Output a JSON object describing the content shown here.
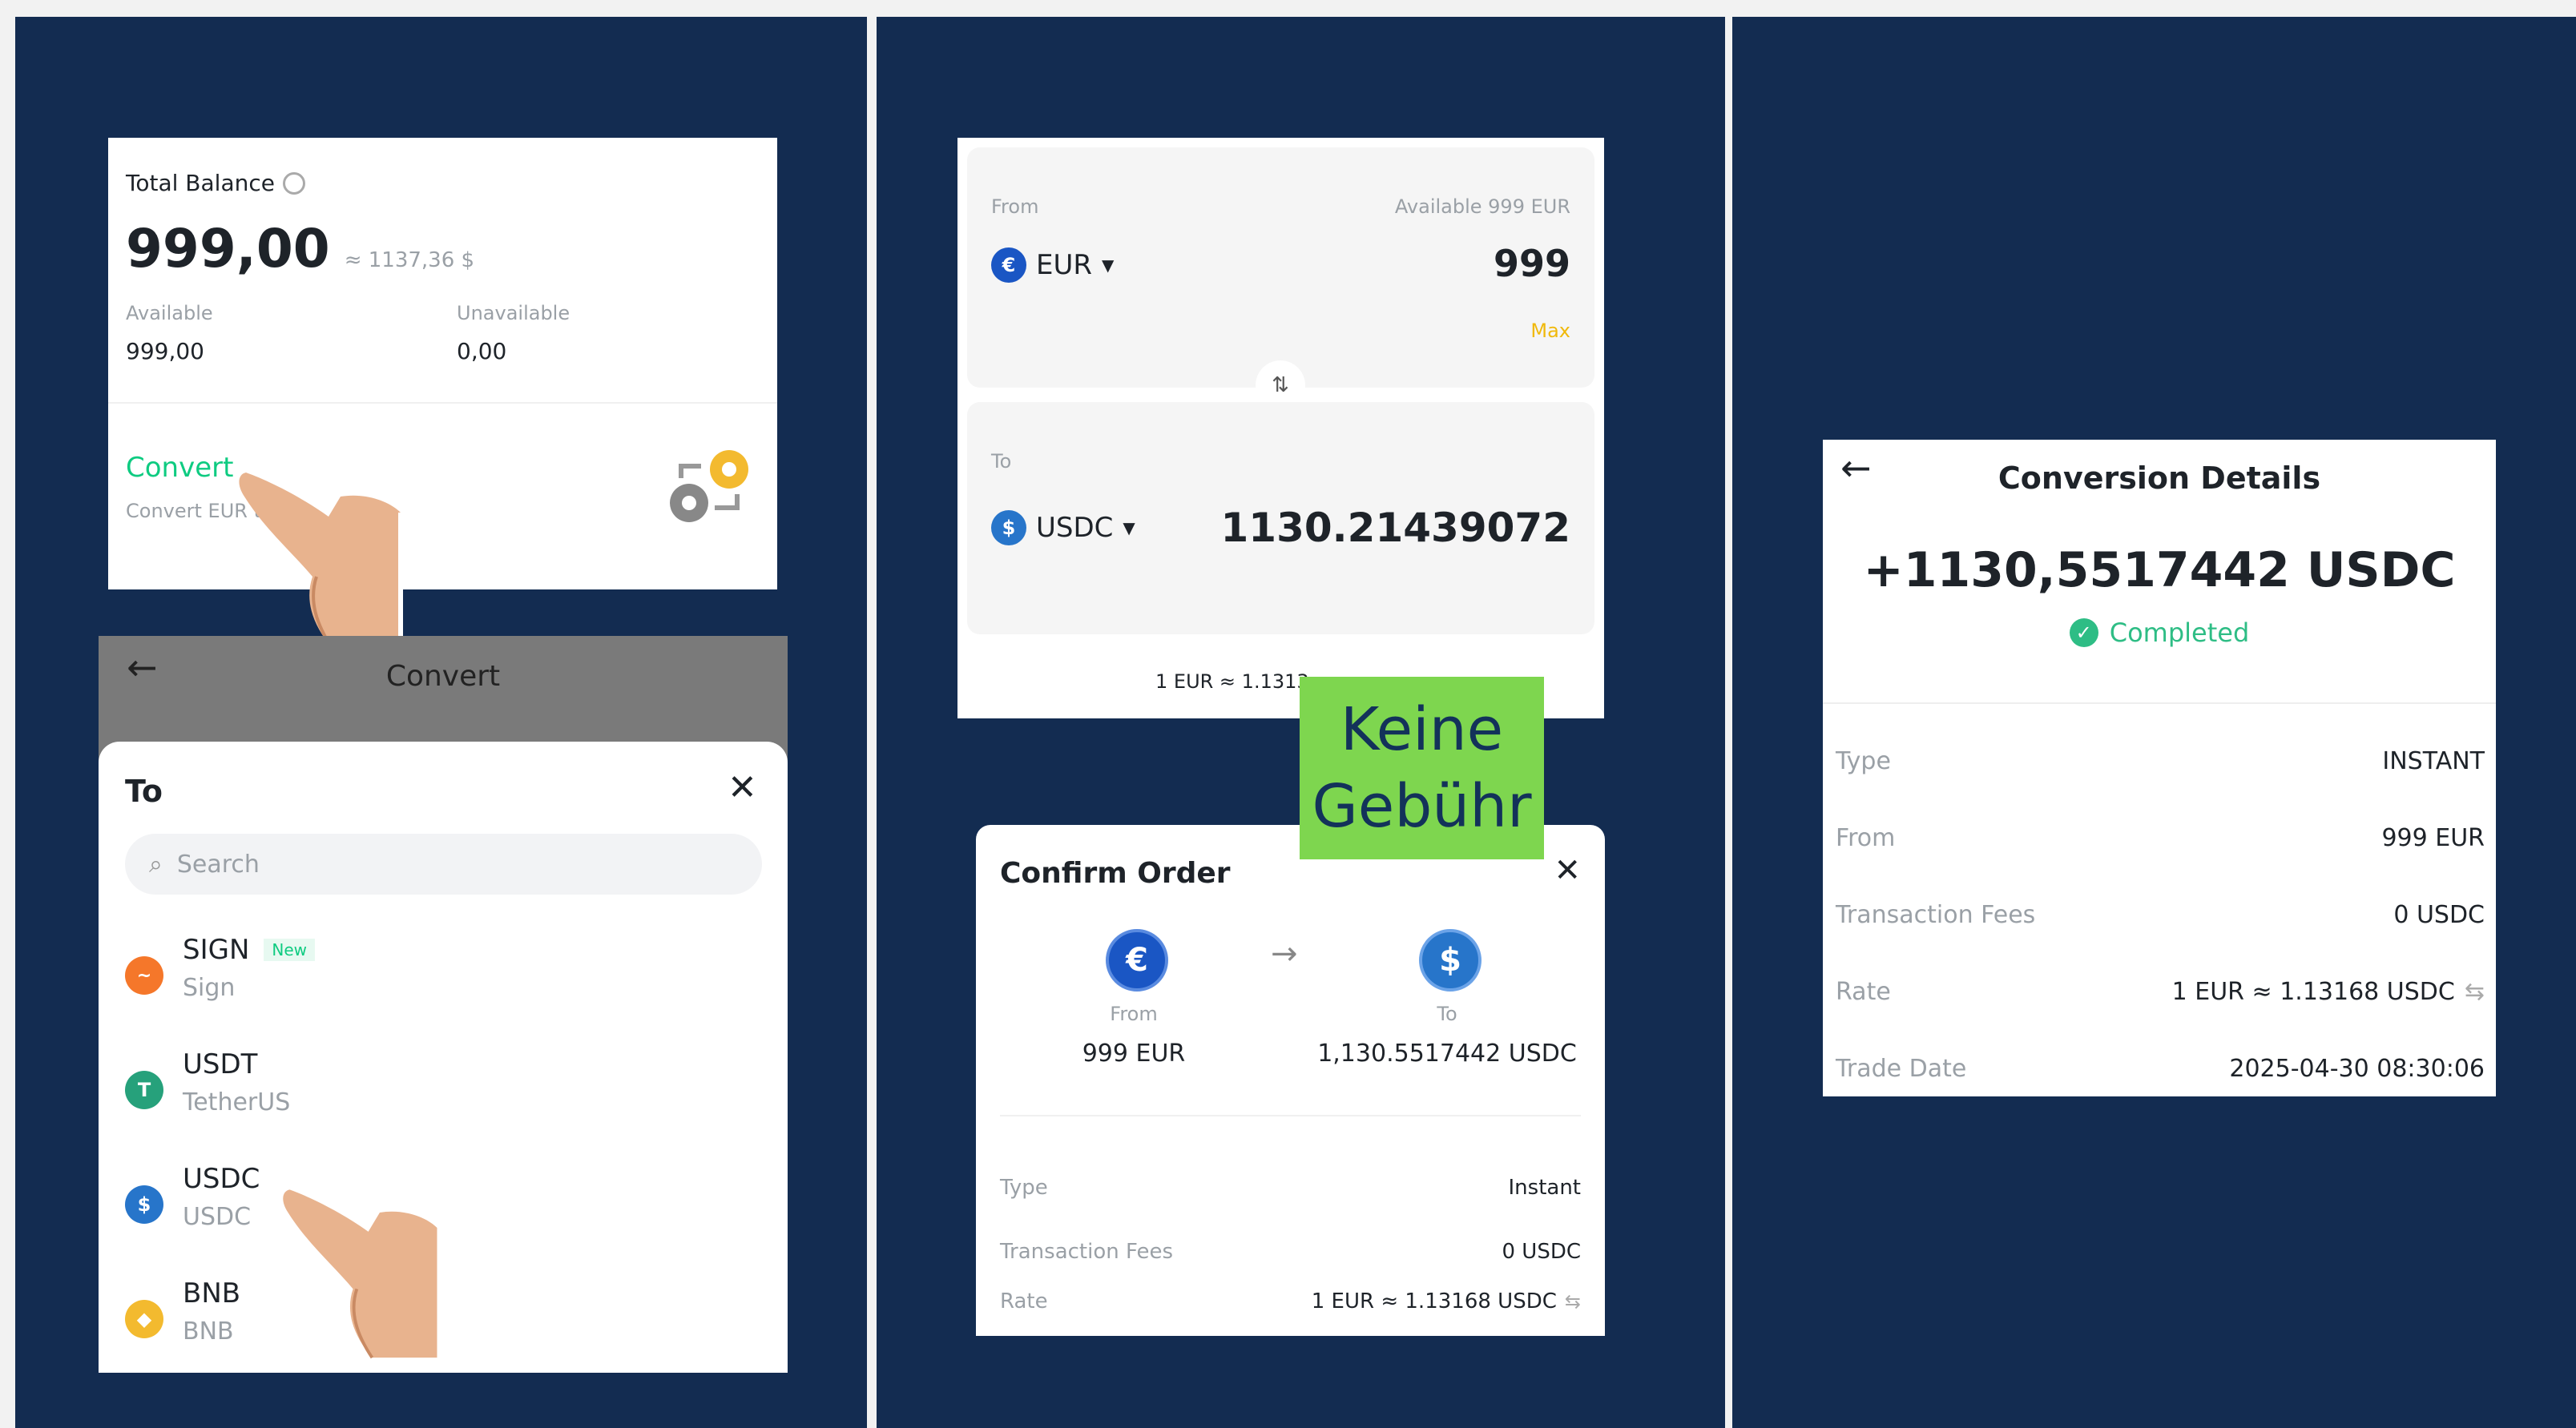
{
  "balance_card": {
    "title": "Total Balance",
    "amount": "999,00",
    "approx": "≈ 1137,36 $",
    "available_label": "Available",
    "available_value": "999,00",
    "unavailable_label": "Unavailable",
    "unavailable_value": "0,00",
    "convert_label": "Convert",
    "convert_sub": "Convert EUR to"
  },
  "convert_sheet": {
    "header_title": "Convert",
    "sheet_title": "To",
    "search_placeholder": "Search",
    "items": [
      {
        "symbol": "SIGN",
        "name": "Sign",
        "badge": "New",
        "color": "#f5772a"
      },
      {
        "symbol": "USDT",
        "name": "TetherUS",
        "badge": "",
        "color": "#26a17b"
      },
      {
        "symbol": "USDC",
        "name": "USDC",
        "badge": "",
        "color": "#2775ca"
      },
      {
        "symbol": "BNB",
        "name": "BNB",
        "badge": "",
        "color": "#f3ba2f"
      }
    ]
  },
  "convert_form": {
    "from_label": "From",
    "available": "Available 999 EUR",
    "from_currency": "EUR",
    "from_amount": "999",
    "max_label": "Max",
    "to_label": "To",
    "to_currency": "USDC",
    "to_amount": "1130.21439072",
    "rate_partial": "1 EUR ≈ 1.1313"
  },
  "callout": {
    "line1": "Keine",
    "line2": "Gebühr"
  },
  "confirm_order": {
    "title": "Confirm Order",
    "from_label": "From",
    "from_value": "999 EUR",
    "to_label": "To",
    "to_value": "1,130.5517442 USDC",
    "type_label": "Type",
    "type_value": "Instant",
    "fees_label": "Transaction Fees",
    "fees_value": "0 USDC",
    "rate_label": "Rate",
    "rate_value": "1 EUR ≈ 1.13168 USDC"
  },
  "conversion_details": {
    "title": "Conversion Details",
    "amount": "+1130,5517442 USDC",
    "status": "Completed",
    "rows": [
      {
        "label": "Type",
        "value": "INSTANT"
      },
      {
        "label": "From",
        "value": "999 EUR"
      },
      {
        "label": "Transaction Fees",
        "value": "0 USDC"
      },
      {
        "label": "Rate",
        "value": "1 EUR ≈ 1.13168 USDC"
      },
      {
        "label": "Trade Date",
        "value": "2025-04-30 08:30:06"
      }
    ]
  },
  "colors": {
    "panel_bg": "#132c51",
    "convert_green": "#0ecb81",
    "max_yellow": "#f0b90b",
    "callout_green": "#7ed64f",
    "completed_green": "#2ebd85"
  }
}
